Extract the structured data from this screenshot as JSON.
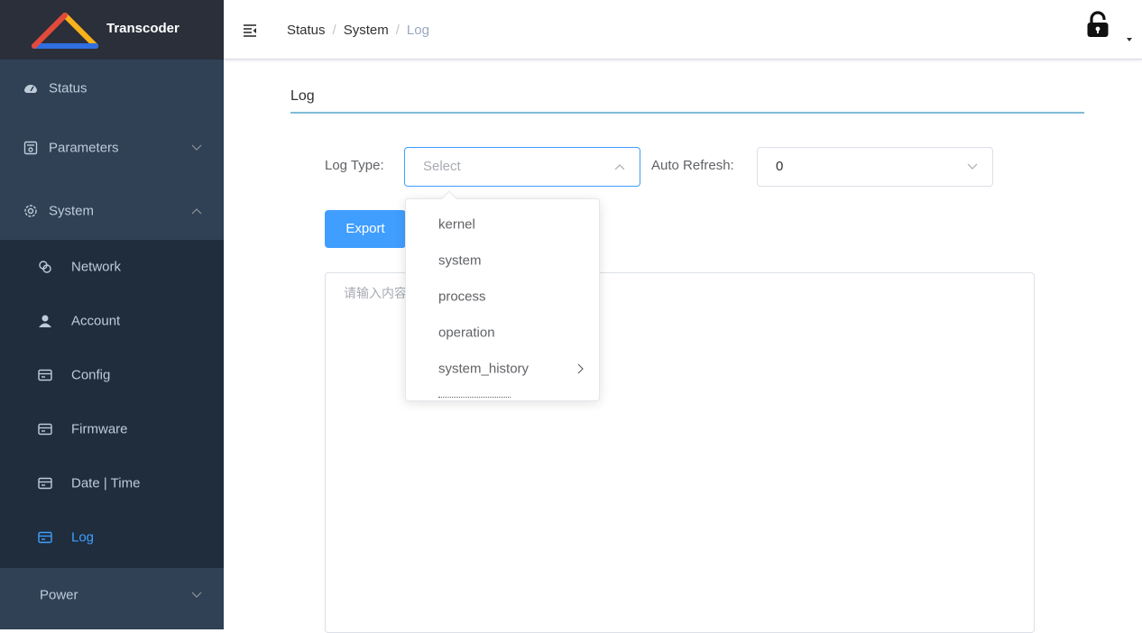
{
  "app": {
    "title": "Transcoder"
  },
  "sidebar": {
    "items": [
      {
        "label": "Status",
        "icon": "dashboard-icon"
      },
      {
        "label": "Parameters",
        "icon": "parameters-icon"
      },
      {
        "label": "System",
        "icon": "gear-icon"
      }
    ],
    "system_sub": [
      {
        "label": "Network",
        "icon": "network-icon"
      },
      {
        "label": "Account",
        "icon": "user-icon"
      },
      {
        "label": "Config",
        "icon": "card-icon"
      },
      {
        "label": "Firmware",
        "icon": "card-icon"
      },
      {
        "label": "Date | Time",
        "icon": "card-icon"
      },
      {
        "label": "Log",
        "icon": "card-icon"
      }
    ],
    "power": {
      "label": "Power"
    }
  },
  "header": {
    "breadcrumb": [
      "Status",
      "System",
      "Log"
    ]
  },
  "main": {
    "section_title": "Log",
    "log_type": {
      "label": "Log Type:",
      "placeholder": "Select"
    },
    "auto_refresh": {
      "label": "Auto Refresh:",
      "value": "0"
    },
    "export_label": "Export",
    "textarea_placeholder": "请输入内容"
  },
  "dropdown": {
    "options": [
      "kernel",
      "system",
      "process",
      "operation",
      "system_history"
    ]
  },
  "colors": {
    "sidebar": "#304156",
    "submenu": "#1f2d3d",
    "accent": "#409eff",
    "underline": "#7fbcd8"
  }
}
